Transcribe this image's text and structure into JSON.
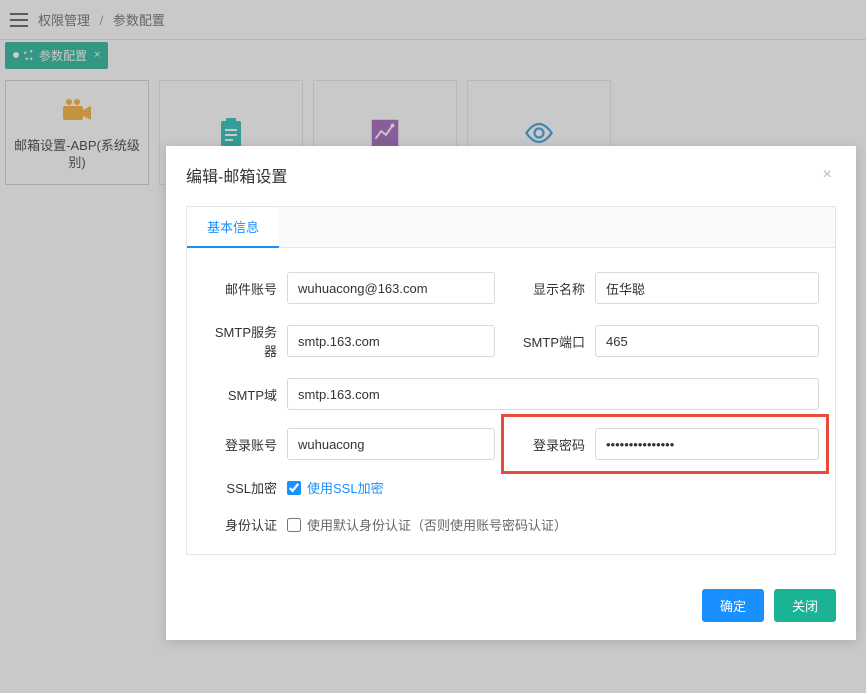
{
  "topbar": {
    "breadcrumb": {
      "level1": "权限管理",
      "level2": "参数配置"
    }
  },
  "tabstrip": {
    "active_tab": "参数配置"
  },
  "cards": [
    {
      "label": "邮箱设置-ABP(系统级别)"
    }
  ],
  "modal": {
    "title": "编辑-邮箱设置",
    "tab": "基本信息",
    "fields": {
      "email_account_label": "邮件账号",
      "email_account_value": "wuhuacong@163.com",
      "display_name_label": "显示名称",
      "display_name_value": "伍华聪",
      "smtp_server_label": "SMTP服务器",
      "smtp_server_value": "smtp.163.com",
      "smtp_port_label": "SMTP端口",
      "smtp_port_value": "465",
      "smtp_domain_label": "SMTP域",
      "smtp_domain_value": "smtp.163.com",
      "login_account_label": "登录账号",
      "login_account_value": "wuhuacong",
      "login_password_label": "登录密码",
      "login_password_value": "•••••••••••••••",
      "ssl_label": "SSL加密",
      "ssl_checkbox_label": "使用SSL加密",
      "ssl_checked": true,
      "auth_label": "身份认证",
      "auth_checkbox_label": "使用默认身份认证（否则使用账号密码认证）",
      "auth_checked": false
    },
    "buttons": {
      "ok": "确定",
      "close": "关闭"
    }
  }
}
